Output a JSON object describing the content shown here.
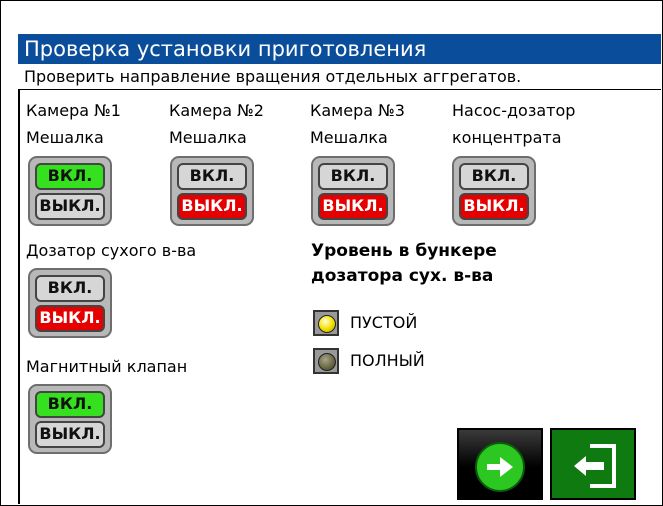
{
  "title": "Проверка установки приготовления",
  "subtitle": "Проверить направление вращения отдельных аггрегатов.",
  "units": [
    {
      "line1": "Камера №1",
      "line2": "Мешалка",
      "on_label": "ВКЛ.",
      "off_label": "ВЫКЛ.",
      "state": "on"
    },
    {
      "line1": "Камера №2",
      "line2": "Мешалка",
      "on_label": "ВКЛ.",
      "off_label": "ВЫКЛ.",
      "state": "off"
    },
    {
      "line1": "Камера №3",
      "line2": "Мешалка",
      "on_label": "ВКЛ.",
      "off_label": "ВЫКЛ.",
      "state": "off"
    },
    {
      "line1": "Насос-дозатор",
      "line2": "концентрата",
      "on_label": "ВКЛ.",
      "off_label": "ВЫКЛ.",
      "state": "off"
    },
    {
      "line1": "Дозатор сухого в-ва",
      "on_label": "ВКЛ.",
      "off_label": "ВЫКЛ.",
      "state": "off"
    },
    {
      "line1": "Магнитный клапан",
      "on_label": "ВКЛ.",
      "off_label": "ВЫКЛ.",
      "state": "on"
    }
  ],
  "level": {
    "title_line1": "Уровень в бункере",
    "title_line2": "дозатора сух. в-ва",
    "indicators": [
      {
        "label": "ПУСТОЙ",
        "state": "lit",
        "color": "#f4e400"
      },
      {
        "label": "ПОЛНЫЙ",
        "state": "unlit",
        "color": "#6d6a45"
      }
    ]
  },
  "nav": {
    "next_icon": "arrow-right-icon",
    "exit_icon": "exit-door-icon"
  },
  "colors": {
    "title_bg": "#0a4e9b",
    "on_active": "#35e01f",
    "off_active": "#e40000",
    "exit_bg": "#0e7a10"
  }
}
